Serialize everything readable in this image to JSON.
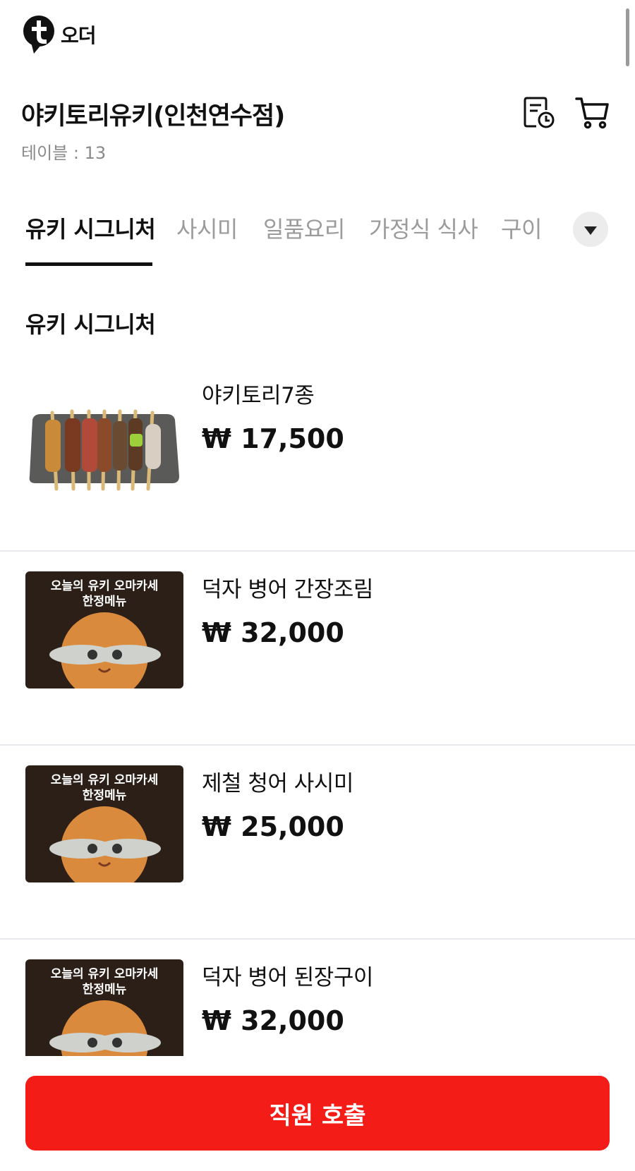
{
  "brand": {
    "logo_text": "오더",
    "accent_color": "#f41c16"
  },
  "store": {
    "name": "야키토리유키(인천연수점)",
    "table_label": "테이블 : 13"
  },
  "header_icons": [
    "order-history-icon",
    "cart-icon"
  ],
  "tabs": [
    {
      "label": "유키 시그니처",
      "active": true
    },
    {
      "label": "사시미",
      "active": false
    },
    {
      "label": "일품요리",
      "active": false
    },
    {
      "label": "가정식 식사",
      "active": false
    },
    {
      "label": "구이",
      "active": false
    }
  ],
  "section": {
    "title": "유키 시그니처"
  },
  "promo_image_text": {
    "line1": "오늘의 유키 오마카세",
    "line2": "한정메뉴"
  },
  "menu_items": [
    {
      "name": "야키토리7종",
      "price": "₩ 17,500",
      "image": "yakitori-skewers-image"
    },
    {
      "name": "덕자 병어 간장조림",
      "price": "₩ 32,000",
      "image": "omakase-cat-fish-image"
    },
    {
      "name": "제철 청어 사시미",
      "price": "₩ 25,000",
      "image": "omakase-cat-fish-image"
    },
    {
      "name": "덕자 병어 된장구이",
      "price": "₩ 32,000",
      "image": "omakase-cat-fish-image"
    }
  ],
  "footer": {
    "call_staff_label": "직원 호출"
  }
}
